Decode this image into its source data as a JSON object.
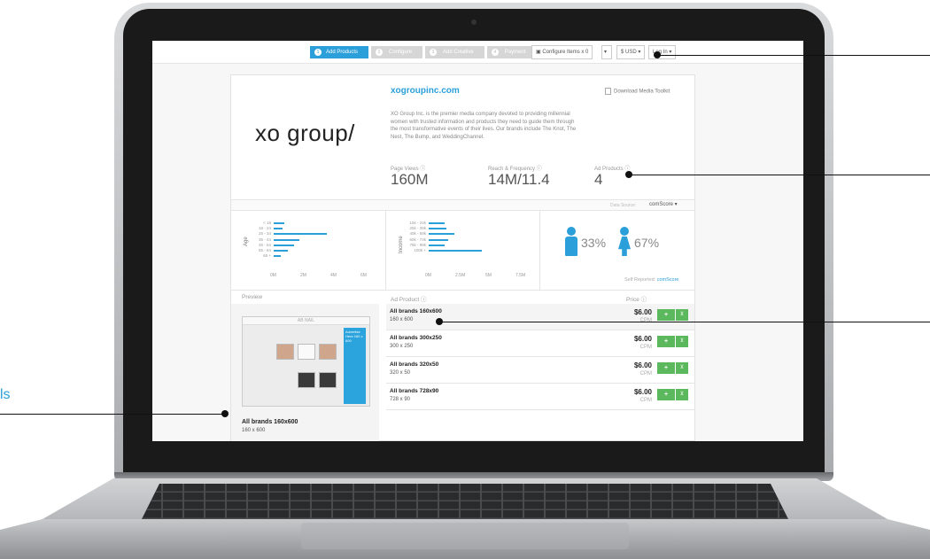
{
  "topbar": {
    "steps": [
      {
        "num": "1",
        "label": "Add Products"
      },
      {
        "num": "2",
        "label": "Configure"
      },
      {
        "num": "3",
        "label": "Add Creative"
      },
      {
        "num": "4",
        "label": "Payment"
      }
    ],
    "cart_label": "Configure Items x 0",
    "currency": "$ USD ▾",
    "login": "Log In ▾"
  },
  "publisher": {
    "logo_text": "xo group/",
    "site": "xogroupinc.com",
    "download": "Download Media Toolkit",
    "description": "XO Group Inc. is the premier media company devoted to providing millennial women with trusted information and products they need to guide them through the most transformative events of their lives. Our brands include The Knot, The Nest, The Bump, and WeddingChannel.",
    "stats": [
      {
        "label": "Page Views ⓘ",
        "value": "160M"
      },
      {
        "label": "Reach & Frequency ⓘ",
        "value": "14M/11.4"
      },
      {
        "label": "Ad Products ⓘ",
        "value": "4"
      }
    ],
    "data_source_label": "Data Source:",
    "data_source_value": "comScore ▾"
  },
  "demographics": {
    "age": {
      "axis_label": "Age",
      "categories": [
        "< 18",
        "18 - 24",
        "25 - 34",
        "35 - 44",
        "45 - 54",
        "55 - 64",
        "65 +"
      ],
      "values": [
        1.2,
        1.0,
        6.2,
        3.0,
        2.4,
        1.6,
        0.8
      ],
      "ticks": [
        "0M",
        "2M",
        "4M",
        "6M"
      ]
    },
    "income": {
      "axis_label": "Income",
      "categories": [
        "15k - 24k",
        "25k - 39k",
        "40k - 59k",
        "60k - 74k",
        "75k - 99k",
        "100k +"
      ],
      "values": [
        1.8,
        2.0,
        3.0,
        2.3,
        1.8,
        6.2
      ],
      "ticks": [
        "0M",
        "2.5M",
        "5M",
        "7.5M"
      ]
    },
    "gender": {
      "male_pct": "33%",
      "female_pct": "67%",
      "self_reported": "Self Reported:",
      "source": "comScore"
    }
  },
  "lower": {
    "preview_header": "Preview",
    "product_header": "Ad Product ⓘ",
    "price_header": "Price ⓘ",
    "thumb_header": "AB NAIL",
    "thumb_ad": "Advertise Here 160 x 600",
    "preview_name": "All brands 160x600",
    "preview_size": "160 x 600",
    "products": [
      {
        "name": "All brands 160x600",
        "size": "160 x 600",
        "price": "$6.00",
        "unit": "CPM"
      },
      {
        "name": "All brands 300x250",
        "size": "300 x 250",
        "price": "$6.00",
        "unit": "CPM"
      },
      {
        "name": "All brands 320x50",
        "size": "320 x 50",
        "price": "$6.00",
        "unit": "CPM"
      },
      {
        "name": "All brands 728x90",
        "size": "728 x 90",
        "price": "$6.00",
        "unit": "CPM"
      }
    ],
    "add_symbol": "+",
    "cart_symbol": "⊻"
  },
  "side_text": "ls"
}
